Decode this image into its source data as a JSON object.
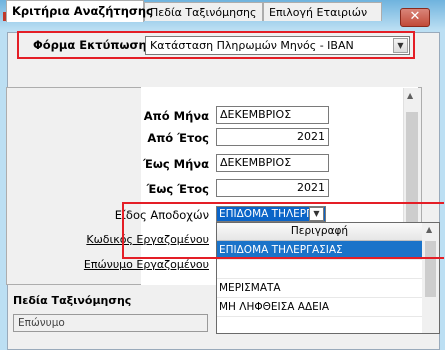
{
  "window": {
    "close_label": "✕",
    "app_icon": "report-icon"
  },
  "form": {
    "label": "Φόρμα Εκτύπωσης",
    "value": "Κατάσταση Πληρωμών Μηνός - IBAN"
  },
  "tabs": [
    {
      "label": "Κριτήρια Αναζήτησης",
      "active": true
    },
    {
      "label": "Πεδία Ταξινόμησης",
      "active": false
    },
    {
      "label": "Επιλογή Εταιριών",
      "active": false
    }
  ],
  "criteria": {
    "from_month_label": "Από Μήνα",
    "from_month_value": "ΔΕΚΕΜΒΡΙΟΣ",
    "from_year_label": "Από Έτος",
    "from_year_value": "2021",
    "to_month_label": "Έως Μήνα",
    "to_month_value": "ΔΕΚΕΜΒΡΙΟΣ",
    "to_year_label": "Έως Έτος",
    "to_year_value": "2021",
    "payment_type_label": "Είδος Αποδοχών",
    "payment_type_value": "ΕΠΙΔΟΜΑ ΤΗΛΕΡΓΑ",
    "employee_code_label": "Κωδικός Εργαζομένου",
    "employee_surname_label": "Επώνυμο Εργαζομένου"
  },
  "dropdown": {
    "header": "Περιγραφή",
    "options": [
      "ΕΠΙΔΟΜΑ ΤΗΛΕΡΓΑΣΙΑΣ",
      "ΜΕΡΙΣΜΑΤΑ",
      "ΜΗ ΛΗΦΘΕΙΣΑ ΑΔΕΙΑ"
    ],
    "selected_index": 0
  },
  "sorting": {
    "label": "Πεδία Ταξινόμησης",
    "value": "Επώνυμο"
  },
  "colors": {
    "highlight": "#e41e26",
    "selection": "#1a73c9"
  }
}
